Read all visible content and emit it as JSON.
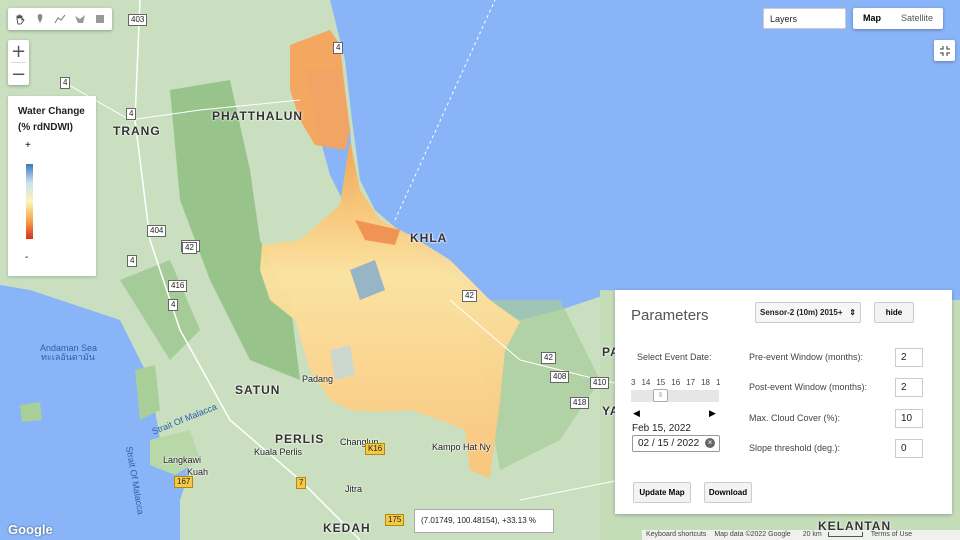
{
  "map": {
    "place_labels": [
      "TRANG",
      "PHATTHALUN",
      "KHLA",
      "SATUN",
      "PERLIS",
      "KEDAH",
      "PATTA",
      "YALA",
      "KELANTAN"
    ],
    "small_labels": [
      "Padang",
      "Changlun",
      "Kuala Perlis",
      "Jitra",
      "Kampo Hat Ny",
      "Langkawi",
      "Kuah"
    ],
    "sea_labels": [
      "Andaman Sea",
      "ทะเลอันดามัน",
      "Strait Of Malacca",
      "Strait Of Malacca"
    ],
    "road_shields": [
      "403",
      "4",
      "4",
      "4",
      "404",
      "416",
      "416",
      "4",
      "4",
      "42",
      "408",
      "42",
      "410",
      "167",
      "7",
      "175",
      "K16",
      "42",
      "418"
    ]
  },
  "draw_tools": {
    "icons": [
      "hand-icon",
      "marker-icon",
      "line-icon",
      "polygon-icon",
      "rectangle-icon"
    ]
  },
  "zoom": {
    "in_label": "+",
    "out_label": "−"
  },
  "layers": {
    "label": "Layers"
  },
  "map_type": {
    "options": [
      "Map",
      "Satellite"
    ],
    "selected": "Map"
  },
  "legend": {
    "title_line1": "Water Change",
    "title_line2": "(% rdNDWI)",
    "plus": "+",
    "minus": "-",
    "colors": {
      "high": "#3b78c2",
      "mid": "#fff4b8",
      "low": "#d7301f"
    }
  },
  "parameters": {
    "title": "Parameters",
    "sensor_select": "Sensor-2 (10m) 2015+",
    "hide_label": "hide",
    "select_event_date_label": "Select Event Date:",
    "date_ticks": [
      "3",
      "14",
      "15",
      "16",
      "17",
      "18",
      "1"
    ],
    "slider_thumb_mark": "|||",
    "prev_arrow": "◀",
    "next_arrow": "▶",
    "date_text": "Feb 15, 2022",
    "date_input_value": "02 / 15 / 2022",
    "pre_event_label": "Pre-event Window (months):",
    "pre_event_value": "2",
    "post_event_label": "Post-event Window (months):",
    "post_event_value": "2",
    "cloud_label": "Max. Cloud Cover (%):",
    "cloud_value": "10",
    "slope_label": "Slope threshold (deg.):",
    "slope_value": "0",
    "update_label": "Update Map",
    "download_label": "Download"
  },
  "readout": {
    "text": "(7.01749, 100.48154), +33.13 %"
  },
  "footer": {
    "google": "Google",
    "keyboard": "Keyboard shortcuts",
    "mapdata": "Map data ©2022 Google",
    "scale": "20 km",
    "terms": "Terms of Use"
  }
}
